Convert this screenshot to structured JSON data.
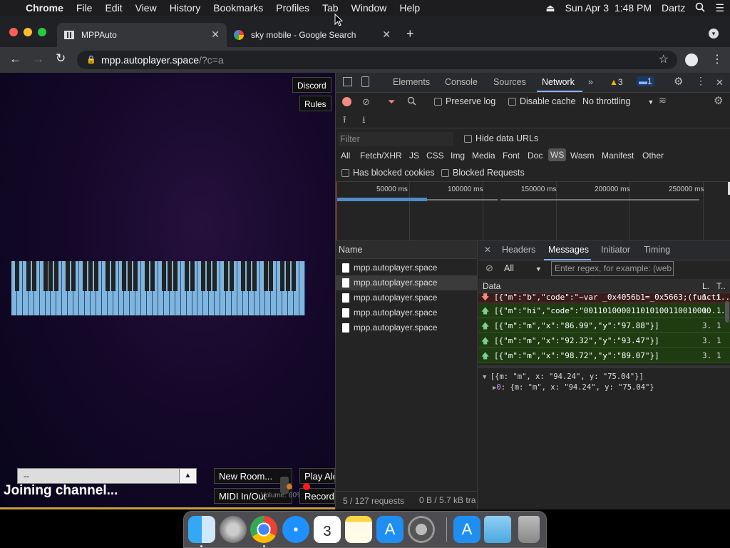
{
  "menubar": {
    "apple": "",
    "app": "Chrome",
    "items": [
      "File",
      "Edit",
      "View",
      "History",
      "Bookmarks",
      "Profiles",
      "Tab",
      "Window",
      "Help"
    ],
    "datetime": "Sun Apr 3  1:48 PM",
    "user": "Dartz"
  },
  "tabs": [
    {
      "title": "MPPAuto"
    },
    {
      "title": "sky mobile - Google Search"
    }
  ],
  "omnibox": {
    "host": "mpp.autoplayer.space",
    "path": "/?c=a"
  },
  "page": {
    "discord": "Discord",
    "rules": "Rules",
    "channel_select": "--",
    "new_room": "New Room...",
    "play_alone": "Play Alo",
    "midi": "MIDI In/Out",
    "volume": "Volume: 60%",
    "record": "Record",
    "status": "Joining channel..."
  },
  "devtools": {
    "tabs": [
      "Elements",
      "Console",
      "Sources",
      "Network"
    ],
    "warnings": "3",
    "messages_count": "1",
    "preserve_log": "Preserve log",
    "disable_cache": "Disable cache",
    "throttling": "No throttling",
    "filter_placeholder": "Filter",
    "hide_data_urls": "Hide data URLs",
    "filters": [
      "All",
      "Fetch/XHR",
      "JS",
      "CSS",
      "Img",
      "Media",
      "Font",
      "Doc",
      "WS",
      "Wasm",
      "Manifest",
      "Other"
    ],
    "has_blocked_cookies": "Has blocked cookies",
    "blocked_requests": "Blocked Requests",
    "timeline_ticks": [
      "50000 ms",
      "100000 ms",
      "150000 ms",
      "200000 ms",
      "250000 ms"
    ],
    "name_header": "Name",
    "requests": [
      "mpp.autoplayer.space",
      "mpp.autoplayer.space",
      "mpp.autoplayer.space",
      "mpp.autoplayer.space",
      "mpp.autoplayer.space"
    ],
    "detail_tabs": [
      "Headers",
      "Messages",
      "Initiator",
      "Timing"
    ],
    "msg_filter": "All",
    "regex_placeholder": "Enter regex, for example: (web",
    "data_header": "Data",
    "len_header": "L.",
    "time_header": "T..",
    "messages": [
      {
        "dir": "down",
        "text": "[{\"m\":\"b\",\"code\":\"~var _0x4056b1=_0x5663;(functi...",
        "len": "1.",
        "time": "1"
      },
      {
        "dir": "up",
        "text": "[{\"m\":\"hi\",\"code\":\"001101000011010100110010000...",
        "len": "1.",
        "time": "1"
      },
      {
        "dir": "up",
        "text": "[{\"m\":\"m\",\"x\":\"86.99\",\"y\":\"97.88\"}]",
        "len": "3.",
        "time": "1"
      },
      {
        "dir": "up",
        "text": "[{\"m\":\"m\",\"x\":\"92.32\",\"y\":\"93.47\"}]",
        "len": "3.",
        "time": "1"
      },
      {
        "dir": "up",
        "text": "[{\"m\":\"m\",\"x\":\"98.72\",\"y\":\"89.07\"}]",
        "len": "3.",
        "time": "1"
      }
    ],
    "preview_line1": "[{m: \"m\", x: \"94.24\", y: \"75.04\"}]",
    "preview_line2_key": "0",
    "preview_line2": ": {m: \"m\", x: \"94.24\", y: \"75.04\"}",
    "status_requests": "5 / 127 requests",
    "status_size": "0 B / 5.7 kB tra"
  },
  "colors": {
    "accent": "#8ab4f8",
    "ws_row": "#1e3b12",
    "warn": "#f4b400",
    "record": "#f28b82"
  }
}
